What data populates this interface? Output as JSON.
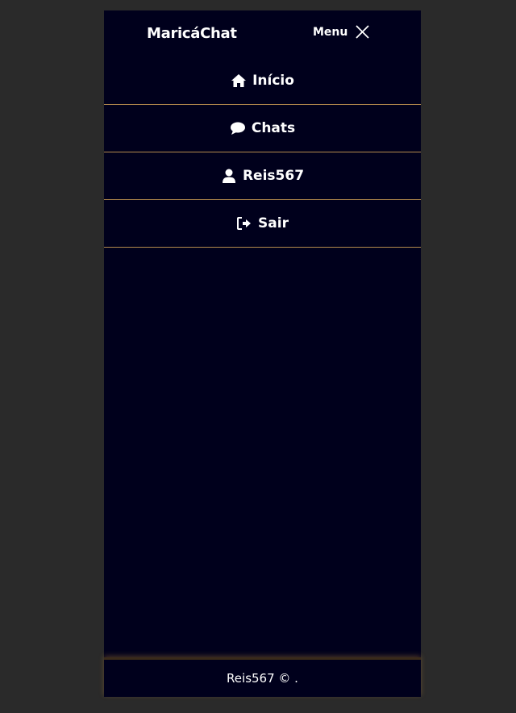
{
  "header": {
    "brand": "MaricáChat",
    "menu_label": "Menu",
    "close_icon": "close-icon"
  },
  "nav": {
    "items": [
      {
        "label": "Início",
        "icon": "home-icon"
      },
      {
        "label": "Chats",
        "icon": "chat-bubble-icon"
      },
      {
        "label": "Reis567",
        "icon": "user-icon"
      },
      {
        "label": "Sair",
        "icon": "logout-icon"
      }
    ]
  },
  "footer": {
    "text": "Reis567 © ."
  },
  "colors": {
    "background": "#00001c",
    "page": "#2a2a2a",
    "divider": "#b48a4d",
    "text": "#ffffff"
  }
}
